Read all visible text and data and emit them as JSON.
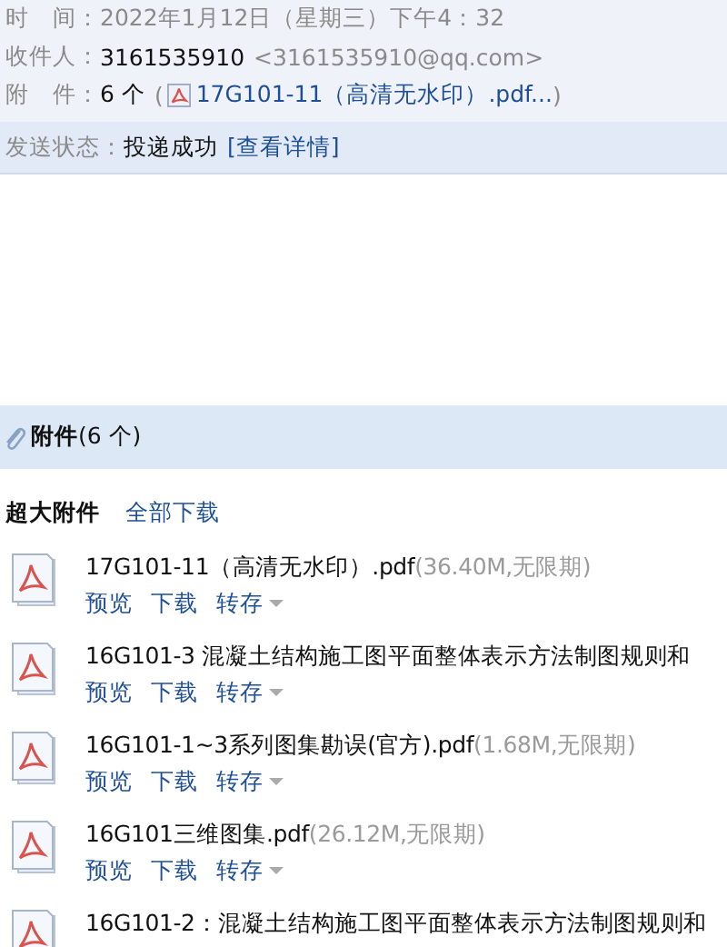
{
  "header": {
    "rows": [
      {
        "kind": "plain",
        "label": "时　间：",
        "value": "2022年1月12日（星期三）下午4：32"
      },
      {
        "kind": "recipient",
        "label": "收件人：",
        "value": "3161535910",
        "extra": "<3161535910@qq.com>"
      },
      {
        "kind": "attachment",
        "label": "附　件：",
        "value": "6 个",
        "open": "(",
        "extra": "17G101-11（高清无水印）.pdf...",
        "close": ")"
      }
    ]
  },
  "status": {
    "label": "发送状态：",
    "value": "投递成功",
    "link": "[查看详情]"
  },
  "attachments": {
    "title": "附件",
    "count": "(6 个)",
    "group_label": "超大附件",
    "download_all": "全部下载",
    "files": [
      {
        "name": "17G101-11（高清无水印）.pdf",
        "meta": "(36.40M,无限期)",
        "actions": [
          "预览",
          "下载",
          "转存"
        ]
      },
      {
        "name": "16G101-3 混凝土结构施工图平面整体表示方法制图规则和",
        "actions": [
          "预览",
          "下载",
          "转存"
        ]
      },
      {
        "name": "16G101-1~3系列图集勘误(官方).pdf",
        "meta": "(1.68M,无限期)",
        "actions": [
          "预览",
          "下载",
          "转存"
        ]
      },
      {
        "name": "16G101三维图集.pdf",
        "meta": "(26.12M,无限期)",
        "actions": [
          "预览",
          "下载",
          "转存"
        ]
      },
      {
        "name": "16G101-2：混凝土结构施工图平面整体表示方法制图规则和"
      }
    ]
  }
}
